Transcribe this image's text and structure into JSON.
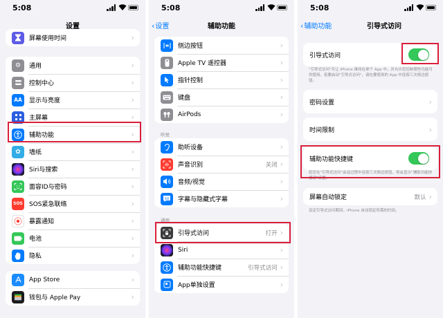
{
  "colors": {
    "accent": "#007aff",
    "toggle_on": "#34c759",
    "highlight": "#d81e3a"
  },
  "screen1": {
    "time": "5:08",
    "title": "设置",
    "top_item": {
      "label": "屏幕使用时间",
      "icon": "hourglass-icon"
    },
    "group2": [
      {
        "label": "通用",
        "icon": "gear-icon"
      },
      {
        "label": "控制中心",
        "icon": "control-center-icon"
      },
      {
        "label": "显示与亮度",
        "icon": "display-brightness-icon",
        "text": "AA"
      },
      {
        "label": "主屏幕",
        "icon": "home-screen-icon"
      },
      {
        "label": "辅助功能",
        "icon": "accessibility-icon"
      },
      {
        "label": "墙纸",
        "icon": "wallpaper-icon"
      },
      {
        "label": "Siri与搜索",
        "icon": "siri-icon"
      },
      {
        "label": "面容ID与密码",
        "icon": "face-id-icon"
      },
      {
        "label": "SOS紧急联络",
        "icon": "sos-icon",
        "text": "SOS"
      },
      {
        "label": "暴露通知",
        "icon": "exposure-notification-icon"
      },
      {
        "label": "电池",
        "icon": "battery-icon"
      },
      {
        "label": "隐私",
        "icon": "privacy-hand-icon"
      }
    ],
    "group3": [
      {
        "label": "App Store",
        "icon": "app-store-icon"
      },
      {
        "label": "钱包与 Apple Pay",
        "icon": "wallet-icon"
      }
    ]
  },
  "screen2": {
    "time": "5:08",
    "back": "设置",
    "title": "辅助功能",
    "group1": [
      {
        "label": "侧边按钮",
        "icon": "side-button-icon"
      },
      {
        "label": "Apple TV 遥控器",
        "icon": "tv-remote-icon"
      },
      {
        "label": "指针控制",
        "icon": "pointer-control-icon"
      },
      {
        "label": "键盘",
        "icon": "keyboard-icon"
      },
      {
        "label": "AirPods",
        "icon": "airpods-icon"
      }
    ],
    "hearing_header": "听觉",
    "group2": [
      {
        "label": "助听设备",
        "icon": "ear-icon",
        "value": ""
      },
      {
        "label": "声音识别",
        "icon": "sound-recognition-icon",
        "value": "关闭"
      },
      {
        "label": "音频/视觉",
        "icon": "audio-visual-icon",
        "value": ""
      },
      {
        "label": "字幕与隐藏式字幕",
        "icon": "subtitles-icon",
        "value": ""
      }
    ],
    "general_header": "通用",
    "group3": [
      {
        "label": "引导式访问",
        "icon": "guided-access-icon",
        "value": "打开"
      },
      {
        "label": "Siri",
        "icon": "siri-icon",
        "value": ""
      },
      {
        "label": "辅助功能快捷键",
        "icon": "accessibility-shortcut-icon",
        "value": "引导式访问"
      },
      {
        "label": "App单独设置",
        "icon": "per-app-settings-icon",
        "value": ""
      }
    ]
  },
  "screen3": {
    "time": "5:08",
    "back": "辅助功能",
    "title": "引导式访问",
    "guided_access": {
      "label": "引导式访问",
      "on": true
    },
    "guided_access_note": "\"引导式访问\"可让 iPhone 维持在单个 App 中，并允许您控制哪些功能可供使用。若要启动\"引导式访问\"，请在要使用的 App 中连按三次侧边按钮。",
    "passcode": {
      "label": "密码设置"
    },
    "time_limits": {
      "label": "时间限制"
    },
    "shortcut": {
      "label": "辅助功能快捷键",
      "on": true
    },
    "shortcut_note": "若您在\"引导式访问\"会话过程中连按三次侧边按钮，将会显示\"辅助功能快捷键\"设置。",
    "auto_lock": {
      "label": "屏幕自动锁定",
      "value": "默认"
    },
    "auto_lock_note": "设定引导式访问期间，iPhone 自动锁定所需的时间。"
  }
}
